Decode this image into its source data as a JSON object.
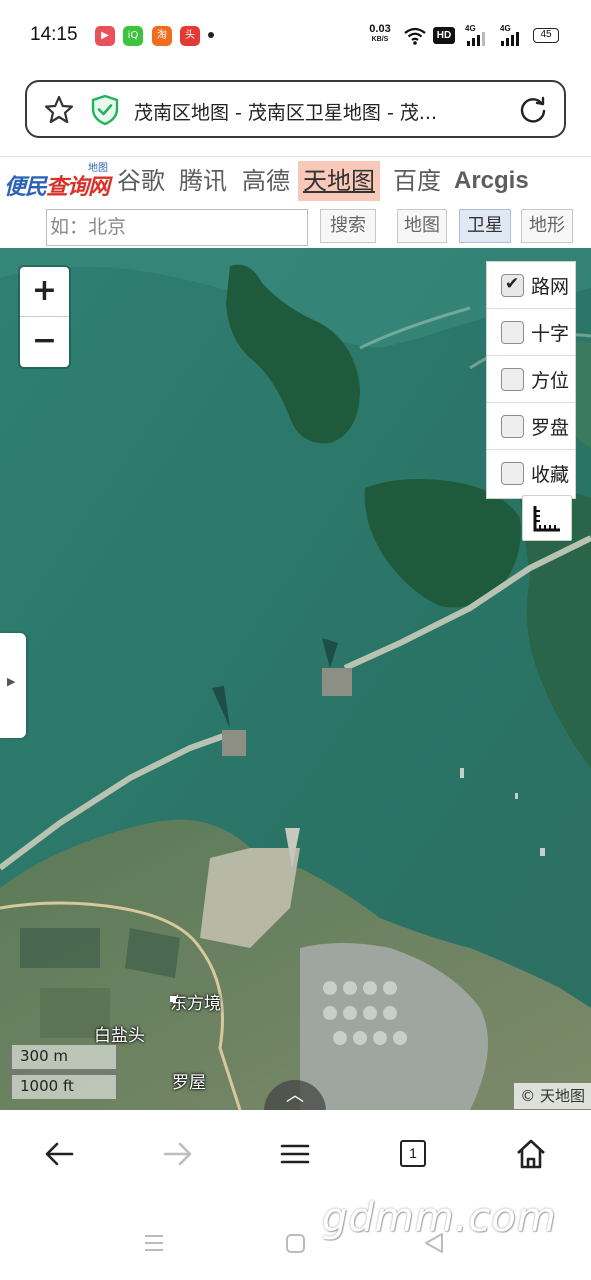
{
  "status_bar": {
    "time": "14:15",
    "net_speed_value": "0.03",
    "net_speed_unit": "KB/S",
    "hd_label": "HD",
    "sim1_label": "4G",
    "sim2_label": "4G",
    "battery": "45"
  },
  "browser": {
    "page_title": "茂南区地图 - 茂南区卫星地图 - 茂...",
    "tabs_count": "1"
  },
  "site": {
    "logo_text_blue": "便民",
    "logo_text_red": "查询网",
    "logo_superscript": "地图",
    "providers": [
      {
        "label": "谷歌",
        "active": false
      },
      {
        "label": "腾讯",
        "active": false
      },
      {
        "label": "高德",
        "active": false
      },
      {
        "label": "天地图",
        "active": true
      },
      {
        "label": "百度",
        "active": false
      },
      {
        "label": "Arcgis",
        "active": false
      }
    ],
    "search_placeholder": "如：北京",
    "search_button": "搜索",
    "map_types": [
      {
        "label": "地图",
        "active": false
      },
      {
        "label": "卫星",
        "active": true
      },
      {
        "label": "地形",
        "active": false
      }
    ]
  },
  "map": {
    "zoom_in": "+",
    "zoom_out": "−",
    "layers": [
      {
        "label": "路网",
        "checked": true
      },
      {
        "label": "十字",
        "checked": false
      },
      {
        "label": "方位",
        "checked": false
      },
      {
        "label": "罗盘",
        "checked": false
      },
      {
        "label": "收藏",
        "checked": false
      }
    ],
    "place_labels": [
      "东方境",
      "白盐头",
      "罗屋"
    ],
    "scale_metric": "300 m",
    "scale_imperial": "1000 ft",
    "attribution": "© 天地图"
  },
  "watermark": "gdmm.com"
}
